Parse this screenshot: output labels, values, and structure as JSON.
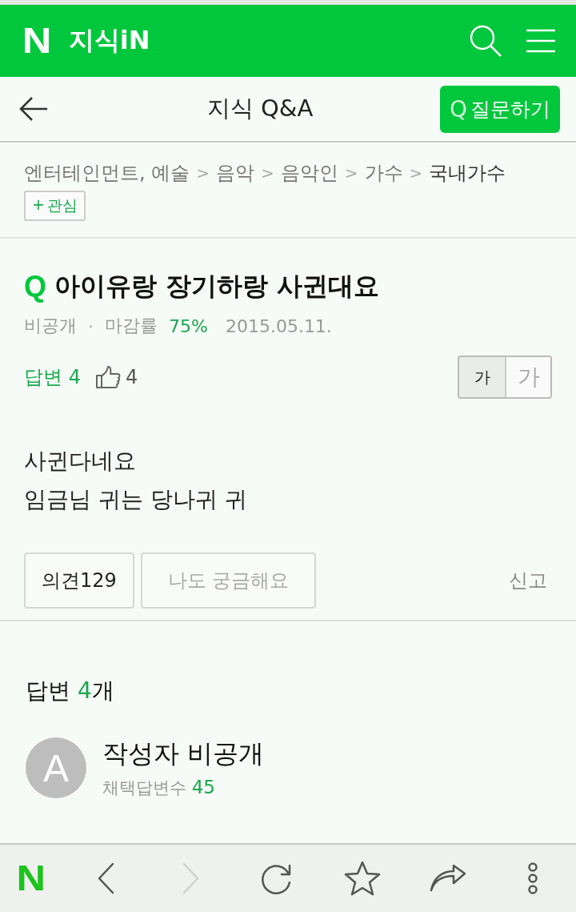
{
  "header": {
    "logo": "N",
    "service": "지식iN"
  },
  "subheader": {
    "title": "지식 Q&A",
    "ask_button": {
      "icon": "Q",
      "label": "질문하기"
    }
  },
  "breadcrumb": {
    "separator": ">",
    "items": [
      {
        "label": "엔터테인먼트, 예술",
        "current": false
      },
      {
        "label": "음악",
        "current": false
      },
      {
        "label": "음악인",
        "current": false
      },
      {
        "label": "가수",
        "current": false
      },
      {
        "label": "국내가수",
        "current": true
      }
    ],
    "follow_button": {
      "icon": "+",
      "label": "관심"
    }
  },
  "question": {
    "mark": "Q",
    "title": "아이유랑 장기하랑 사귄대요",
    "author": "비공개",
    "separator": "·",
    "close_rate_label": "마감률",
    "close_rate": "75%",
    "date": "2015.05.11.",
    "answers_count": "답변 4",
    "likes": "4",
    "font_sizes": [
      {
        "label": "가",
        "selected": true
      },
      {
        "label": "가",
        "selected": false
      }
    ],
    "body": [
      "사귄다네요",
      "임금님 귀는 당나귀 귀"
    ],
    "opinion_button": "의견129",
    "curious_button": "나도 궁금해요",
    "report_link": "신고"
  },
  "answers": {
    "heading": "답변",
    "count": "4",
    "unit": "개",
    "first": {
      "avatar": "A",
      "author": "작성자 비공개",
      "adopted_label": "채택답변수",
      "adopted_count": "45"
    }
  },
  "toolbar": [
    {
      "kind": "logo",
      "label": "N",
      "disabled": false
    },
    {
      "kind": "back",
      "disabled": false
    },
    {
      "kind": "forward",
      "disabled": true
    },
    {
      "kind": "reload",
      "disabled": false
    },
    {
      "kind": "bookmark",
      "disabled": false
    },
    {
      "kind": "share",
      "disabled": false
    },
    {
      "kind": "more",
      "disabled": false
    }
  ]
}
